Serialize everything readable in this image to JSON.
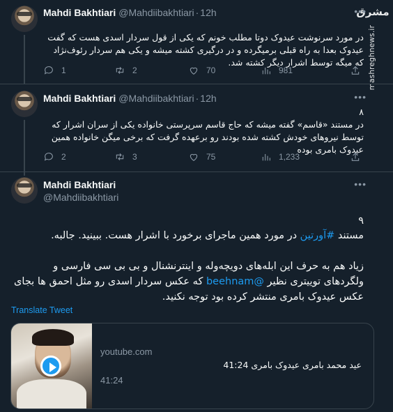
{
  "watermark": {
    "logo": "مشرق",
    "url": "mashreghnews.ir"
  },
  "tweets": [
    {
      "name": "Mahdi Bakhtiari",
      "handle": "@Mahdiibakhtiari",
      "separator": "·",
      "time": "12h",
      "text": "در مورد سرنوشت عیدوک دوتا مطلب خونم که یکی از قول سردار اسدی هست که گفت عیدوک بعدا به راه قبلی برمیگرده و در درگیری کشته میشه و یکی هم سردار رئوف‌نژاد که میگه توسط اشرار دیگر کشته شد.",
      "replies": "1",
      "retweets": "2",
      "likes": "70",
      "views": "981"
    },
    {
      "name": "Mahdi Bakhtiari",
      "handle": "@Mahdiibakhtiari",
      "separator": "·",
      "time": "12h",
      "number": "۸",
      "text": "در مستند «قاسم» گفته میشه که حاج قاسم سرپرستی خانواده یکی از سران اشرار که توسط نیروهای خودش کشته شده بودند رو برعهده گرفت که برخی میگن خانواده همین عیدوک بامری بوده",
      "replies": "2",
      "retweets": "3",
      "likes": "75",
      "views": "1,233"
    }
  ],
  "main_tweet": {
    "name": "Mahdi Bakhtiari",
    "handle": "@Mahdiibakhtiari",
    "number": "۹",
    "line1_pre": "مستند ",
    "line1_hashtag": "#آورتین",
    "line1_post": " در مورد همین ماجرای برخورد با اشرار هست. ببینید. جالبه.",
    "para2_a": "زیاد هم به حرف این ابله‌های دویچه‌وله و اینترنشنال و بی بی سی فارسی و ولگردهای توییتری نظیر ",
    "para2_mention": "@beehnam",
    "para2_b": " که عکس سردار اسدی رو مثل احمق ها بجای عکس عیدوک بامری منتشر کرده بود توجه نکنید.",
    "translate_label": "Translate Tweet",
    "card": {
      "domain": "youtube.com",
      "title": "عید محمد بامری عیدوک بامری 41:24",
      "duration": "41:24"
    }
  }
}
